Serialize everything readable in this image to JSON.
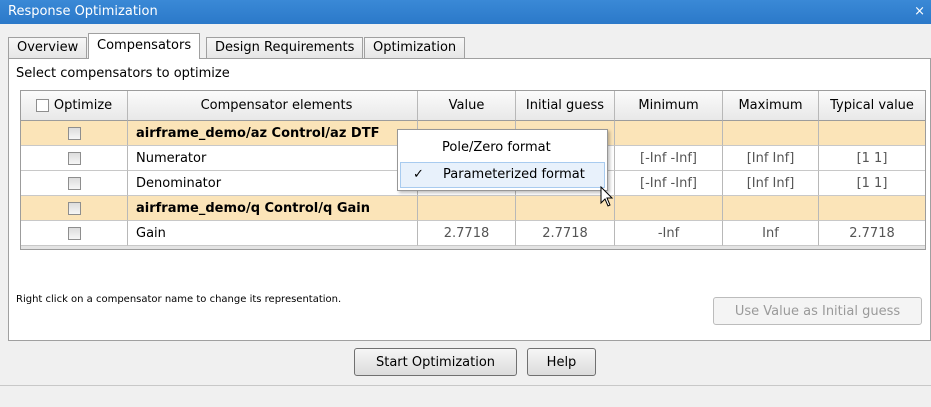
{
  "window": {
    "title": "Response Optimization",
    "close_glyph": "×"
  },
  "tabs": [
    {
      "label": "Overview"
    },
    {
      "label": "Compensators"
    },
    {
      "label": "Design Requirements"
    },
    {
      "label": "Optimization"
    }
  ],
  "group_label": "Select compensators to optimize",
  "table": {
    "headers": [
      "Optimize",
      "Compensator elements",
      "Value",
      "Initial guess",
      "Minimum",
      "Maximum",
      "Typical value"
    ],
    "rows": [
      {
        "kind": "group",
        "name": "airframe_demo/az Control/az DTF"
      },
      {
        "kind": "data",
        "name": "Numerator",
        "value": "",
        "initial": "",
        "min": "[-Inf -Inf]",
        "max": "[Inf Inf]",
        "typical": "[1 1]"
      },
      {
        "kind": "data",
        "name": "Denominator",
        "value": "",
        "initial": "",
        "min": "[-Inf -Inf]",
        "max": "[Inf Inf]",
        "typical": "[1 1]"
      },
      {
        "kind": "group",
        "name": "airframe_demo/q Control/q Gain"
      },
      {
        "kind": "data",
        "name": "Gain",
        "value": "2.7718",
        "initial": "2.7718",
        "min": "-Inf",
        "max": "Inf",
        "typical": "2.7718"
      }
    ]
  },
  "context_menu": {
    "items": [
      {
        "label": "Pole/Zero format",
        "checked": false
      },
      {
        "label": "Parameterized format",
        "checked": true,
        "check_glyph": "✓"
      }
    ]
  },
  "hint": "Right click on a compensator name to change its representation.",
  "buttons": {
    "use_value": "Use Value as Initial guess",
    "start": "Start Optimization",
    "help": "Help"
  }
}
